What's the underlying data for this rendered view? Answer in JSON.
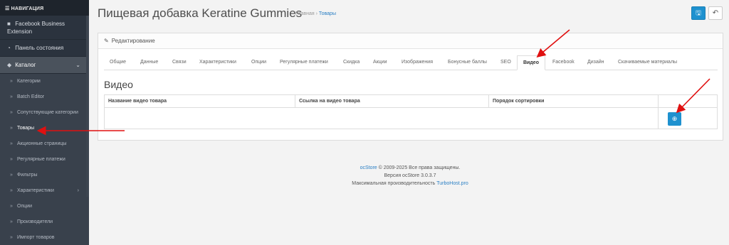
{
  "sidebar": {
    "nav_title": "☰ НАВИГАЦИЯ",
    "items": [
      {
        "icon": "facebook-icon",
        "label": "Facebook Business Extension"
      },
      {
        "icon": "dashboard-icon",
        "label": "Панель состояния"
      },
      {
        "icon": "tag-icon",
        "label": "Каталог"
      }
    ],
    "catalog_sub": [
      {
        "label": "Категории"
      },
      {
        "label": "Batch Editor"
      },
      {
        "label": "Сопутствующие категории"
      },
      {
        "label": "Товары"
      },
      {
        "label": "Акционные страницы"
      },
      {
        "label": "Регулярные платежи"
      },
      {
        "label": "Фильтры"
      },
      {
        "label": "Характеристики"
      },
      {
        "label": "Опции"
      },
      {
        "label": "Производители"
      },
      {
        "label": "Импорт товаров"
      }
    ]
  },
  "header": {
    "title": "Пищевая добавка Keratine Gummies",
    "breadcrumb_home": "Главная",
    "breadcrumb_sep": "›",
    "breadcrumb_current": "Товары"
  },
  "panel": {
    "heading": "Редактирование",
    "tabs": [
      "Общие",
      "Данные",
      "Связи",
      "Характеристики",
      "Опции",
      "Регулярные платежи",
      "Скидка",
      "Акции",
      "Изображения",
      "Бонусные баллы",
      "SEO",
      "Видео",
      "Facebook",
      "Дизайн",
      "Скачиваемые материалы"
    ],
    "active_tab": "Видео",
    "section_title": "Видео",
    "table_headers": [
      "Название видео товара",
      "Ссылка на видео товара",
      "Порядок сортировки"
    ]
  },
  "footer": {
    "brand": "ocStore",
    "copyright": "© 2009-2025 Все права защищены.",
    "version": "Версия ocStore 3.0.3.7",
    "performance": "Максимальная производительность",
    "host": "TurboHost.pro"
  },
  "colors": {
    "sidebar_bg": "#2b333e",
    "accent_blue": "#1e91cf",
    "annotation_red": "#e01010"
  }
}
